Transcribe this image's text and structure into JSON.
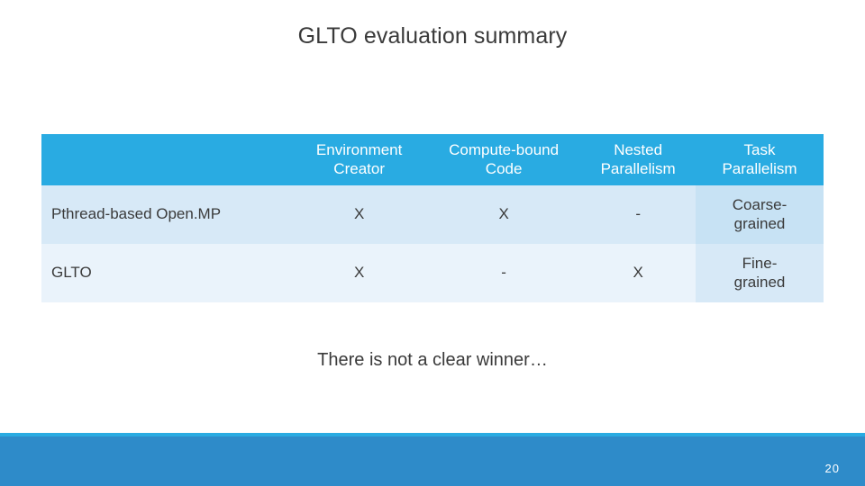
{
  "slide": {
    "title": "GLTO evaluation summary",
    "caption": "There is not a clear winner…",
    "page_number": "20",
    "colors": {
      "header_fill": "#29ABE2",
      "row_a_fill": "#D7E9F7",
      "row_b_fill": "#EAF3FB",
      "footer_band": "#2E8BC9",
      "text": "#3A3A3A"
    }
  },
  "table": {
    "headers": {
      "blank": "",
      "col1_line1": "Environment",
      "col1_line2": "Creator",
      "col2_line1": "Compute-bound",
      "col2_line2": "Code",
      "col3_line1": "Nested",
      "col3_line2": "Parallelism",
      "col4_line1": "Task",
      "col4_line2": "Parallelism"
    },
    "rows": [
      {
        "label": "Pthread-based Open.MP",
        "environment_creator": "X",
        "compute_bound_code": "X",
        "nested_parallelism": "-",
        "task_parallelism_line1": "Coarse-",
        "task_parallelism_line2": "grained"
      },
      {
        "label": "GLTO",
        "environment_creator": "X",
        "compute_bound_code": "-",
        "nested_parallelism": "X",
        "task_parallelism_line1": "Fine-",
        "task_parallelism_line2": "grained"
      }
    ]
  }
}
